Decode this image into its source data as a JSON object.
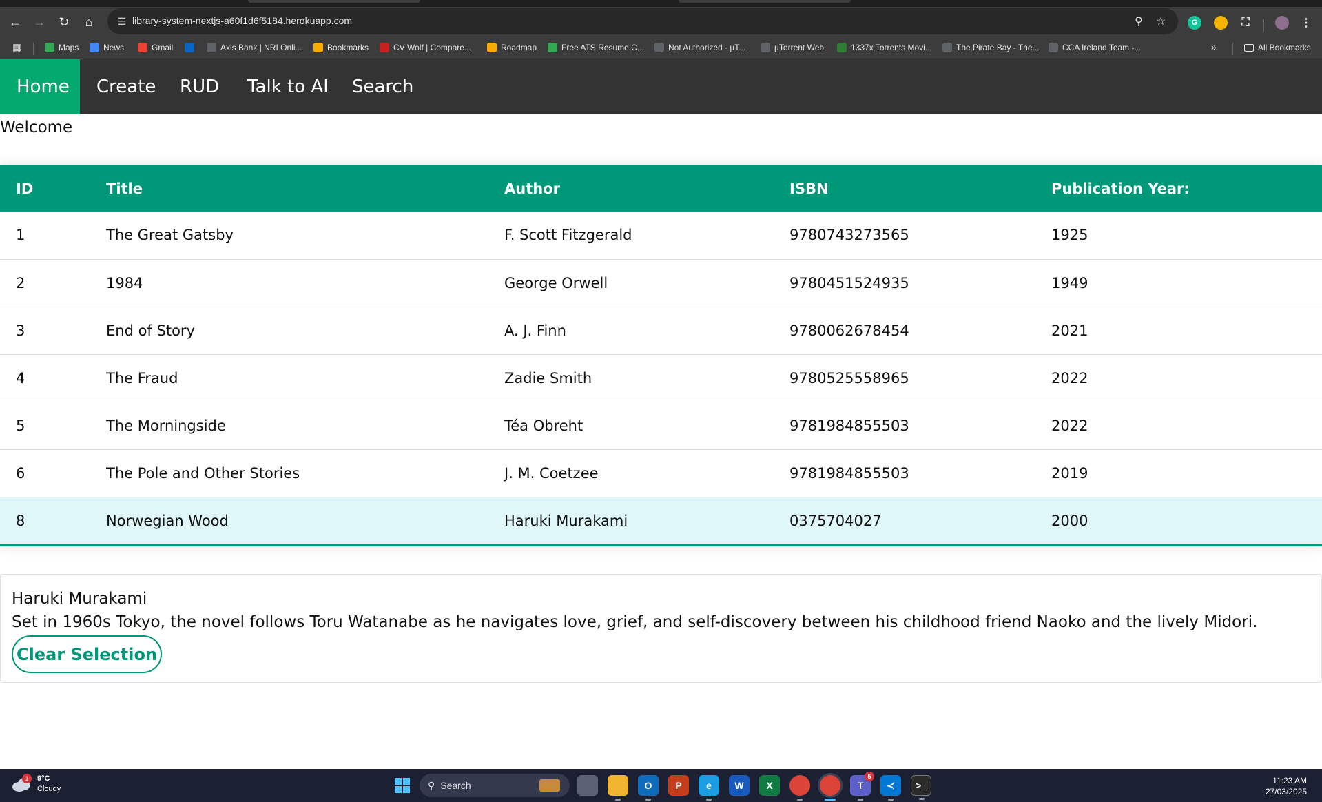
{
  "browser": {
    "url": "library-system-nextjs-a60f1d6f5184.herokuapp.com",
    "bookmarks": [
      {
        "label": "Maps",
        "icon": "maps-icon",
        "color": "#34a853"
      },
      {
        "label": "News",
        "icon": "news-icon",
        "color": "#4285f4"
      },
      {
        "label": "Gmail",
        "icon": "gmail-icon",
        "color": "#ea4335"
      },
      {
        "label": "",
        "icon": "linkedin-icon",
        "color": "#0a66c2"
      },
      {
        "label": "Axis Bank | NRI Onli...",
        "icon": "globe-icon",
        "color": "#5f6368"
      },
      {
        "label": "Bookmarks",
        "icon": "bookmarks-icon",
        "color": "#f9ab00"
      },
      {
        "label": "CV Wolf | Compare...",
        "icon": "cvwolf-icon",
        "color": "#c5221f"
      },
      {
        "label": "Roadmap",
        "icon": "roadmap-icon",
        "color": "#f9ab00"
      },
      {
        "label": "Free ATS Resume C...",
        "icon": "ats-icon",
        "color": "#34a853"
      },
      {
        "label": "Not Authorized · µT...",
        "icon": "globe-icon",
        "color": "#5f6368"
      },
      {
        "label": "µTorrent Web",
        "icon": "globe-icon",
        "color": "#5f6368"
      },
      {
        "label": "1337x Torrents Movi...",
        "icon": "1337x-icon",
        "color": "#2e7d32"
      },
      {
        "label": "The Pirate Bay - The...",
        "icon": "piratebay-icon",
        "color": "#5f6368"
      },
      {
        "label": "CCA Ireland Team -...",
        "icon": "globe-icon",
        "color": "#5f6368"
      }
    ],
    "overflow_label": "»",
    "all_bookmarks": "All Bookmarks"
  },
  "nav": {
    "items": [
      {
        "label": "Home",
        "active": true
      },
      {
        "label": "Create",
        "active": false
      },
      {
        "label": "RUD",
        "active": false
      },
      {
        "label": "Talk to AI",
        "active": false
      },
      {
        "label": "Search",
        "active": false
      }
    ]
  },
  "welcome_text": "Welcome",
  "table": {
    "headers": [
      "ID",
      "Title",
      "Author",
      "ISBN",
      "Publication Year:"
    ],
    "rows": [
      {
        "id": "1",
        "title": "The Great Gatsby",
        "author": "F. Scott Fitzgerald",
        "isbn": "9780743273565",
        "year": "1925"
      },
      {
        "id": "2",
        "title": "1984",
        "author": "George Orwell",
        "isbn": "9780451524935",
        "year": "1949"
      },
      {
        "id": "3",
        "title": "End of Story",
        "author": "A. J. Finn",
        "isbn": "9780062678454",
        "year": "2021"
      },
      {
        "id": "4",
        "title": "The Fraud",
        "author": "Zadie Smith",
        "isbn": "9780525558965",
        "year": "2022"
      },
      {
        "id": "5",
        "title": "The Morningside",
        "author": "Téa Obreht",
        "isbn": "9781984855503",
        "year": "2022"
      },
      {
        "id": "6",
        "title": "The Pole and Other Stories",
        "author": "J. M. Coetzee",
        "isbn": "9781984855503",
        "year": "2019"
      },
      {
        "id": "8",
        "title": "Norwegian Wood",
        "author": "Haruki Murakami",
        "isbn": "0375704027",
        "year": "2000",
        "selected": true
      }
    ]
  },
  "detail": {
    "author": "Haruki Murakami",
    "description": "Set in 1960s Tokyo, the novel follows Toru Watanabe as he navigates love, grief, and self-discovery between his childhood friend Naoko and the lively Midori.",
    "clear_label": "Clear Selection"
  },
  "colors": {
    "accent": "#009879",
    "nav_active": "#04aa6d",
    "nav_bg": "#333333",
    "selected_row": "#e0f7fa"
  },
  "taskbar": {
    "weather_temp": "9°C",
    "weather_desc": "Cloudy",
    "weather_badge": "1",
    "search_label": "Search",
    "teams_badge": "5",
    "time": "11:23 AM",
    "date": "27/03/2025"
  }
}
